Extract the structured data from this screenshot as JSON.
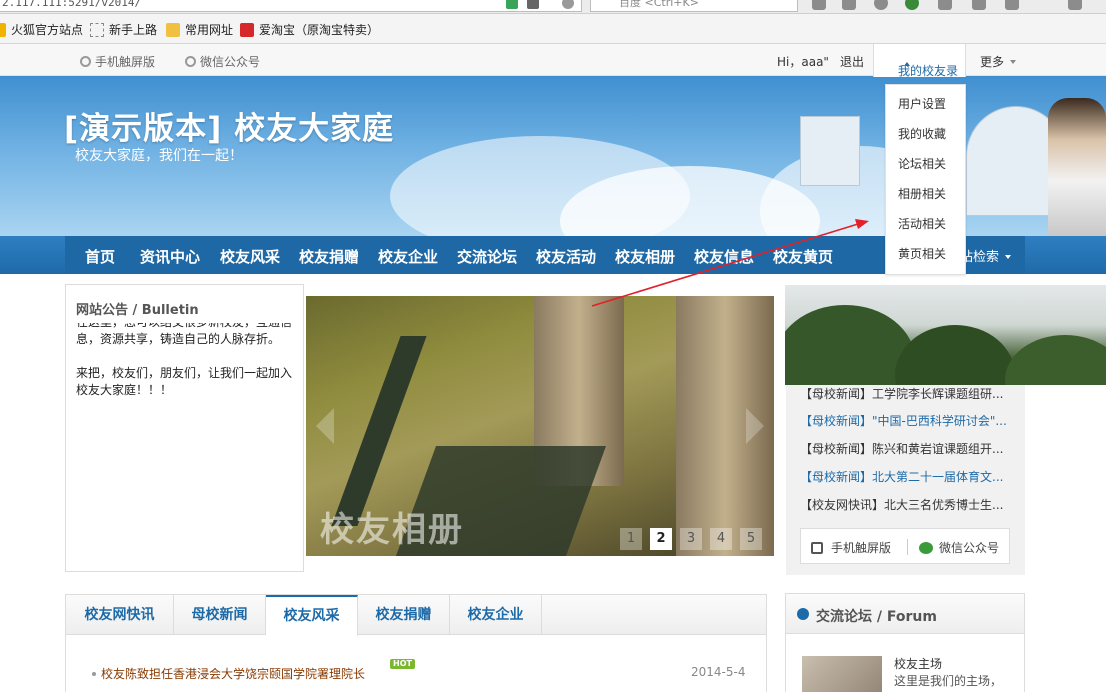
{
  "browser": {
    "url_fragment": "2.117.111:5291/v2014/",
    "search_placeholder": "百度 <Ctrl+K>",
    "bookmarks": [
      "火狐官方站点",
      "新手上路",
      "常用网址",
      "爱淘宝（原淘宝特卖）"
    ]
  },
  "topbar": {
    "mobile_label": "手机触屏版",
    "wechat_label": "微信公众号",
    "greeting": "Hi，aaa\"",
    "logout_label": "退出",
    "mine_label": "我的校友录",
    "more_label": "更多"
  },
  "dropdown": {
    "items": [
      "用户设置",
      "我的收藏",
      "论坛相关",
      "相册相关",
      "活动相关",
      "黄页相关"
    ]
  },
  "banner": {
    "title": "[演示版本] 校友大家庭",
    "slogan": "校友大家庭，我们在一起！"
  },
  "nav": {
    "items": [
      "首页",
      "资讯中心",
      "校友风采",
      "校友捐赠",
      "校友企业",
      "交流论坛",
      "校友活动",
      "校友相册",
      "校友信息",
      "校友黄页"
    ],
    "search_label": "站检索"
  },
  "bulletin": {
    "title": "网站公告 / Bulletin",
    "lines": [
      "在这里，您可以结交很多新校友，互通信",
      "息，资源共享，铸造自己的人脉存折。",
      "",
      "来把，校友们，朋友们，让我们一起加入",
      "校友大家庭！！！"
    ]
  },
  "slideshow": {
    "caption": "校友相册",
    "pages": [
      "1",
      "2",
      "3",
      "4",
      "5"
    ],
    "active_page": "2"
  },
  "right_news": {
    "items": [
      "【母校新闻】工学院李长辉课题组研...",
      "【母校新闻】\"中国-巴西科学研讨会\"...",
      "【母校新闻】陈兴和黄岩谊课题组开...",
      "【母校新闻】北大第二十一届体育文...",
      "【校友网快讯】北大三名优秀博士生..."
    ],
    "mobile_btn": "手机触屏版",
    "wechat_btn": "微信公众号"
  },
  "tabs": {
    "items": [
      "校友网快讯",
      "母校新闻",
      "校友风采",
      "校友捐赠",
      "校友企业"
    ],
    "active": "校友风采",
    "article_title": "校友陈致担任香港浸会大学饶宗颐国学院署理院长",
    "article_badge": "HOT",
    "article_date": "2014-5-4"
  },
  "forum": {
    "title": "交流论坛 / Forum",
    "board_name": "校友主场",
    "board_desc": "这里是我们的主场，"
  },
  "colors": {
    "nav_blue": "#1e68a6",
    "link_blue": "#1d6aa8",
    "annotation_red": "#e3202a"
  }
}
